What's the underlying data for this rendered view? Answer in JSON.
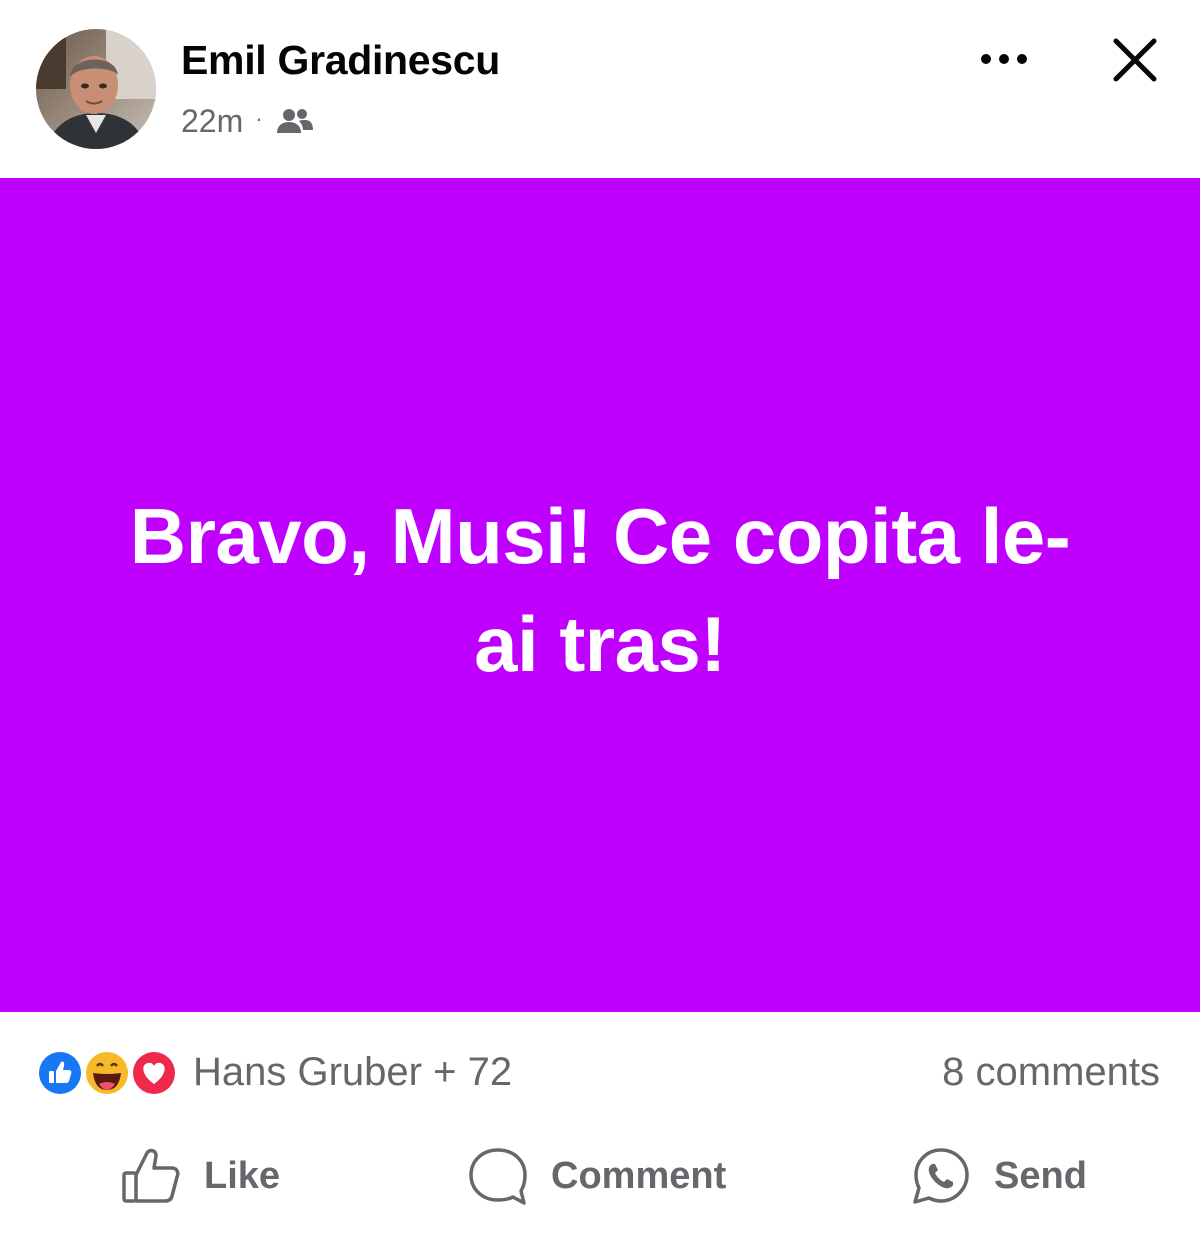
{
  "post": {
    "author": "Emil Gradinescu",
    "time": "22m",
    "separator": "·",
    "audience_icon": "friends-icon",
    "text": "Bravo, Musi! Ce copita le-ai tras!",
    "background_color": "#bf00ff",
    "text_color": "#ffffff"
  },
  "header": {
    "more_icon": "more-horizontal-icon",
    "close_icon": "close-icon"
  },
  "reactions": {
    "icons": [
      "like-reaction-icon",
      "haha-reaction-icon",
      "love-reaction-icon"
    ],
    "summary": "Hans Gruber + 72",
    "comments": "8 comments"
  },
  "actions": {
    "like_label": "Like",
    "comment_label": "Comment",
    "send_label": "Send"
  }
}
